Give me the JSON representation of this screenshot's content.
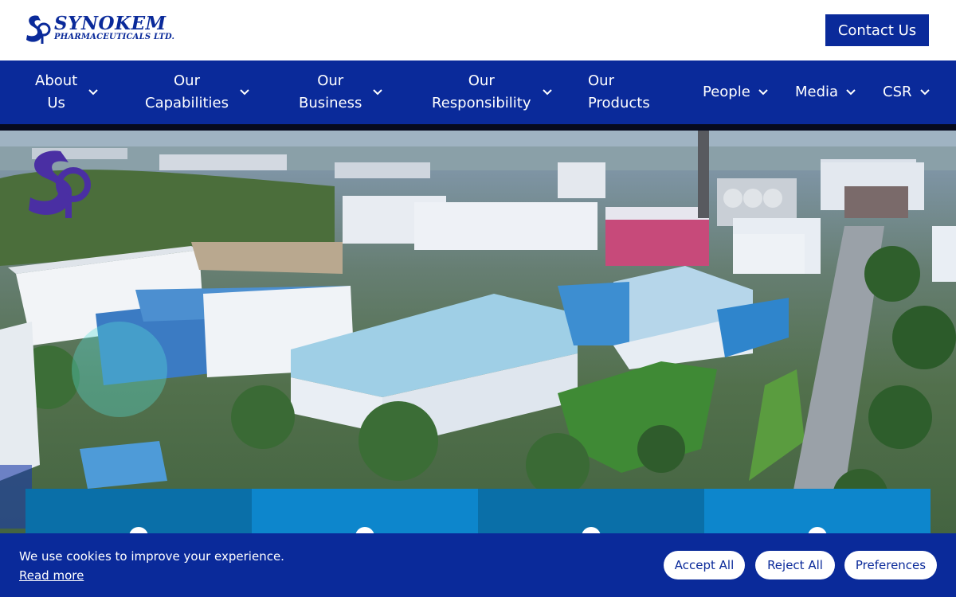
{
  "header": {
    "logo": {
      "name": "SYNOKEM",
      "sub": "PHARMACEUTICALS LTD."
    },
    "contact_label": "Contact Us"
  },
  "nav": {
    "items": [
      {
        "label": "About\nUs",
        "dropdown": true
      },
      {
        "label": "Our\nCapabilities",
        "dropdown": true
      },
      {
        "label": "Our\nBusiness",
        "dropdown": true
      },
      {
        "label": "Our\nResponsibility",
        "dropdown": true
      },
      {
        "label": "Our\nProducts",
        "dropdown": false
      },
      {
        "label": "People",
        "dropdown": true
      },
      {
        "label": "Media",
        "dropdown": true
      },
      {
        "label": "CSR",
        "dropdown": true
      }
    ]
  },
  "hero": {
    "image": "aerial-factory-campus",
    "tiles": [
      {
        "color": "#0a6fa8"
      },
      {
        "color": "#0d86cc"
      },
      {
        "color": "#0a6fa8"
      },
      {
        "color": "#0d86cc"
      }
    ]
  },
  "cookie": {
    "message": "We use cookies to improve your experience.",
    "read_more": "Read more",
    "buttons": {
      "accept": "Accept All",
      "reject": "Reject All",
      "preferences": "Preferences"
    }
  },
  "colors": {
    "brand": "#0a2a9a",
    "tile_dark": "#0a6fa8",
    "tile_light": "#0d86cc"
  },
  "icons": {
    "chevron": "chevron-down-icon",
    "logo": "synokem-logo-icon"
  }
}
